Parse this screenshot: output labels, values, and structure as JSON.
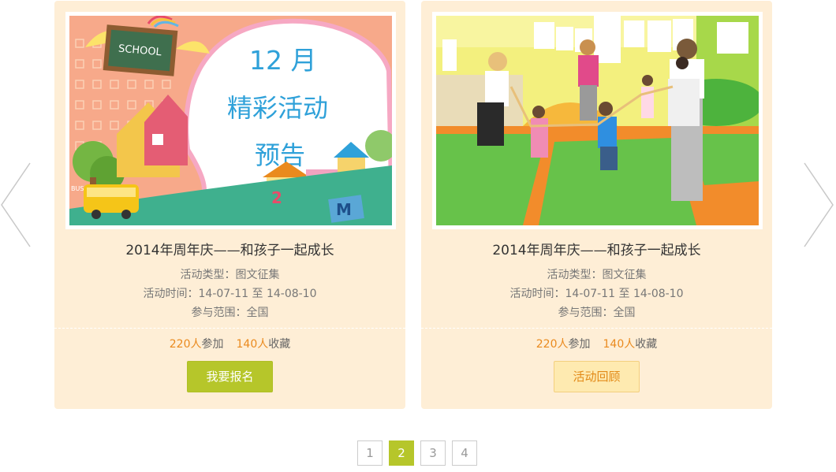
{
  "colors": {
    "card_bg": "#feeed6",
    "accent_green": "#b6c62a",
    "accent_orange": "#ea8a1e",
    "review_bg": "#feeab0"
  },
  "nav": {
    "prev_icon": "chevron-left-icon",
    "next_icon": "chevron-right-icon"
  },
  "cards": [
    {
      "poster": {
        "line1": "12 月",
        "line2": "精彩活动",
        "line3": "预告",
        "sign": "SCHOOL",
        "bus": "BUS",
        "badge": "M"
      },
      "title": "2014年周年庆——和孩子一起成长",
      "type": "活动类型：图文征集",
      "time": "活动时间：14-07-11 至 14-08-10",
      "scope": "参与范围：全国",
      "participants": "220人",
      "participants_suffix": "参加",
      "favorites": "140人",
      "favorites_suffix": "收藏",
      "button": "我要报名"
    },
    {
      "title": "2014年周年庆——和孩子一起成长",
      "type": "活动类型：图文征集",
      "time": "活动时间：14-07-11 至 14-08-10",
      "scope": "参与范围：全国",
      "participants": "220人",
      "participants_suffix": "参加",
      "favorites": "140人",
      "favorites_suffix": "收藏",
      "button": "活动回顾"
    }
  ],
  "pagination": {
    "pages": [
      "1",
      "2",
      "3",
      "4"
    ],
    "current": "2"
  }
}
